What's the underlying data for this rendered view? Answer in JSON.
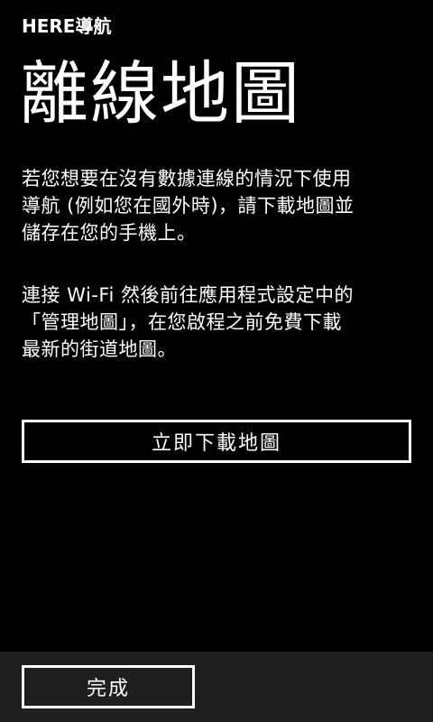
{
  "app": {
    "title": "HERE導航"
  },
  "page": {
    "title": "離線地圖",
    "paragraph1": "若您想要在沒有數據連線的情況下使用\n導航 (例如您在國外時)，請下載地圖並\n儲存在您的手機上。",
    "paragraph2": "連接 Wi-Fi 然後前往應用程式設定中的\n「管理地圖」，在您啟程之前免費下載\n最新的街道地圖。",
    "download_button_label": "立即下載地圖"
  },
  "app_bar": {
    "done_button_label": "完成"
  },
  "colors": {
    "background": "#000000",
    "foreground": "#ffffff",
    "app_bar": "#1f1f1f"
  }
}
